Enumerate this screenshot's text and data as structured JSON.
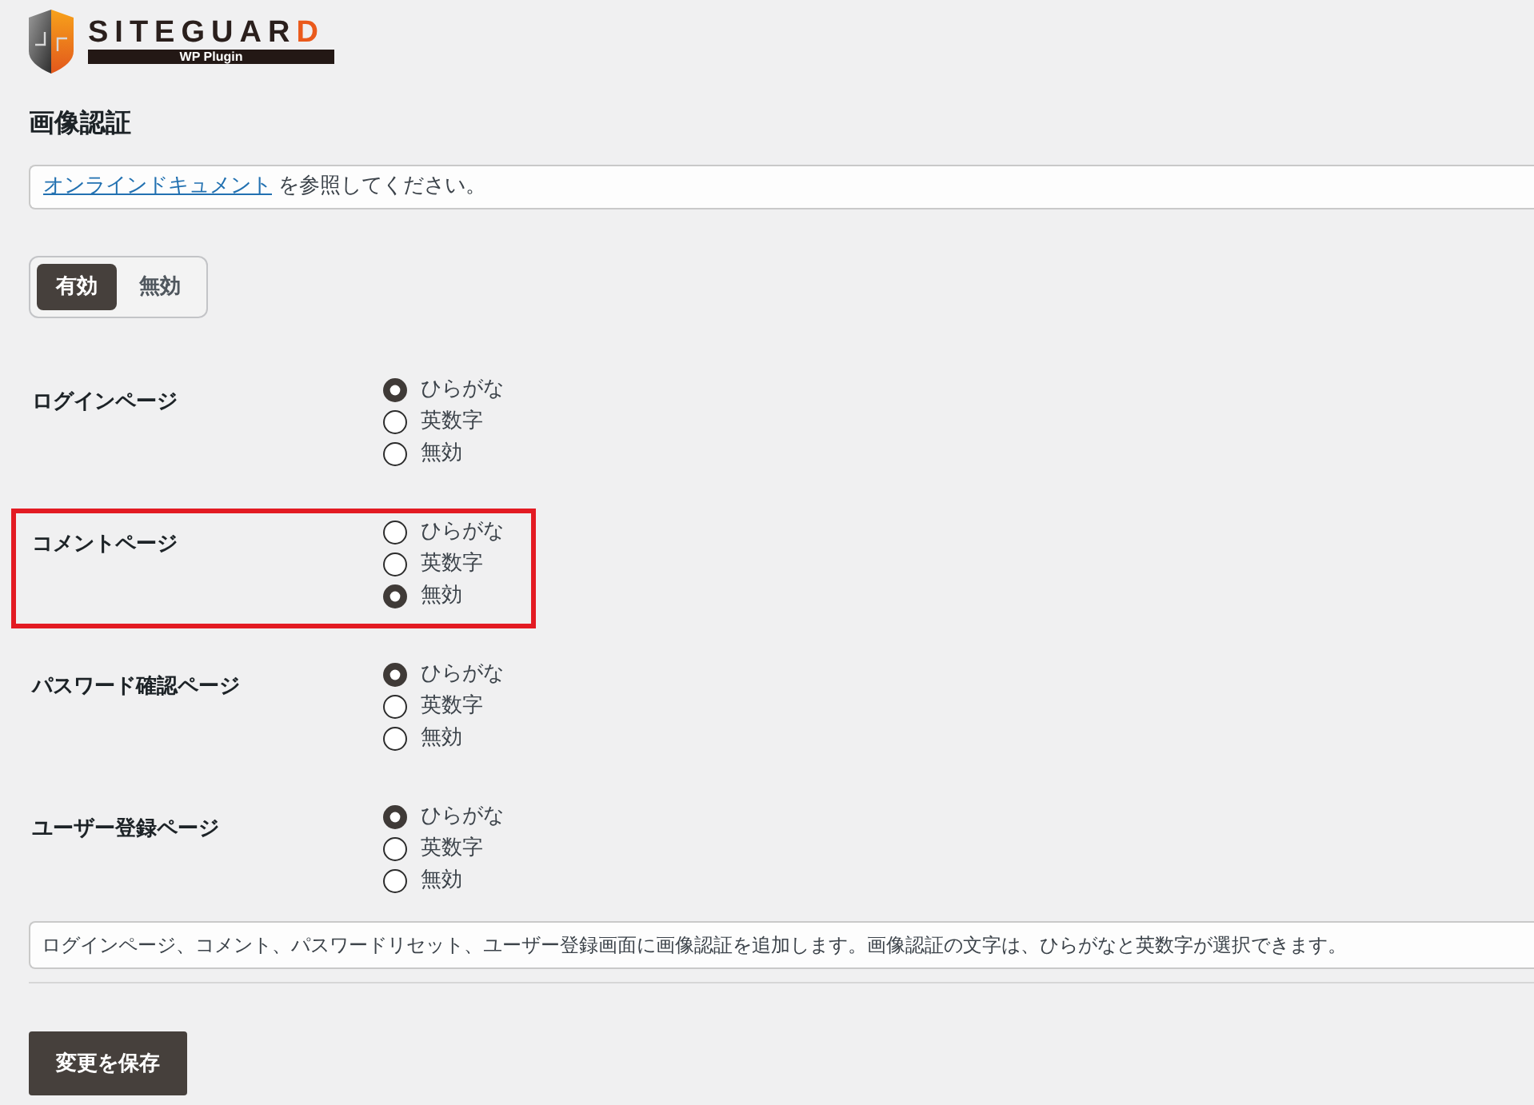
{
  "logo": {
    "wordmark": "SITEGUARD",
    "tagline": "WP Plugin"
  },
  "page_title": "画像認証",
  "doc_notice": {
    "link": "オンラインドキュメント",
    "text": " を参照してください。"
  },
  "toggle": [
    {
      "label": "有効",
      "selected": true
    },
    {
      "label": "無効",
      "selected": false
    }
  ],
  "settings": [
    {
      "label": "ログインページ",
      "highlighted": false,
      "options": [
        {
          "label": "ひらがな",
          "selected": true
        },
        {
          "label": "英数字",
          "selected": false
        },
        {
          "label": "無効",
          "selected": false
        }
      ]
    },
    {
      "label": "コメントページ",
      "highlighted": true,
      "options": [
        {
          "label": "ひらがな",
          "selected": false
        },
        {
          "label": "英数字",
          "selected": false
        },
        {
          "label": "無効",
          "selected": true
        }
      ]
    },
    {
      "label": "パスワード確認ページ",
      "highlighted": false,
      "options": [
        {
          "label": "ひらがな",
          "selected": true
        },
        {
          "label": "英数字",
          "selected": false
        },
        {
          "label": "無効",
          "selected": false
        }
      ]
    },
    {
      "label": "ユーザー登録ページ",
      "highlighted": false,
      "options": [
        {
          "label": "ひらがな",
          "selected": true
        },
        {
          "label": "英数字",
          "selected": false
        },
        {
          "label": "無効",
          "selected": false
        }
      ]
    }
  ],
  "description": "ログインページ、コメント、パスワードリセット、ユーザー登録画面に画像認証を追加します。画像認証の文字は、ひらがなと英数字が選択できます。",
  "save_button": "変更を保存"
}
